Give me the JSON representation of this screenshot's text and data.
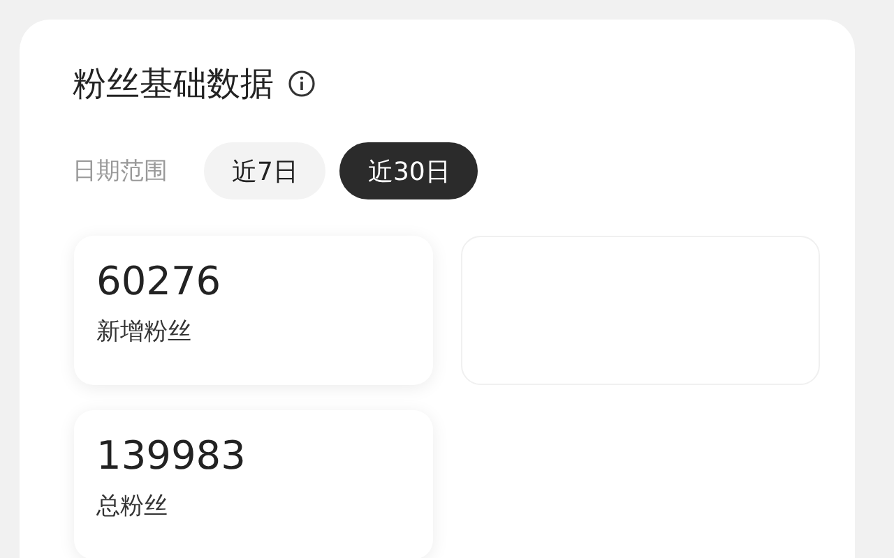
{
  "panel": {
    "title": "粉丝基础数据"
  },
  "date_range": {
    "label": "日期范围",
    "options": [
      {
        "label": "近7日",
        "selected": false
      },
      {
        "label": "近30日",
        "selected": true
      }
    ]
  },
  "stats": [
    {
      "kind": "metric",
      "value": "60276",
      "label": "新增粉丝"
    },
    {
      "kind": "empty"
    },
    {
      "kind": "metric",
      "value": "139983",
      "label": "总粉丝"
    }
  ]
}
